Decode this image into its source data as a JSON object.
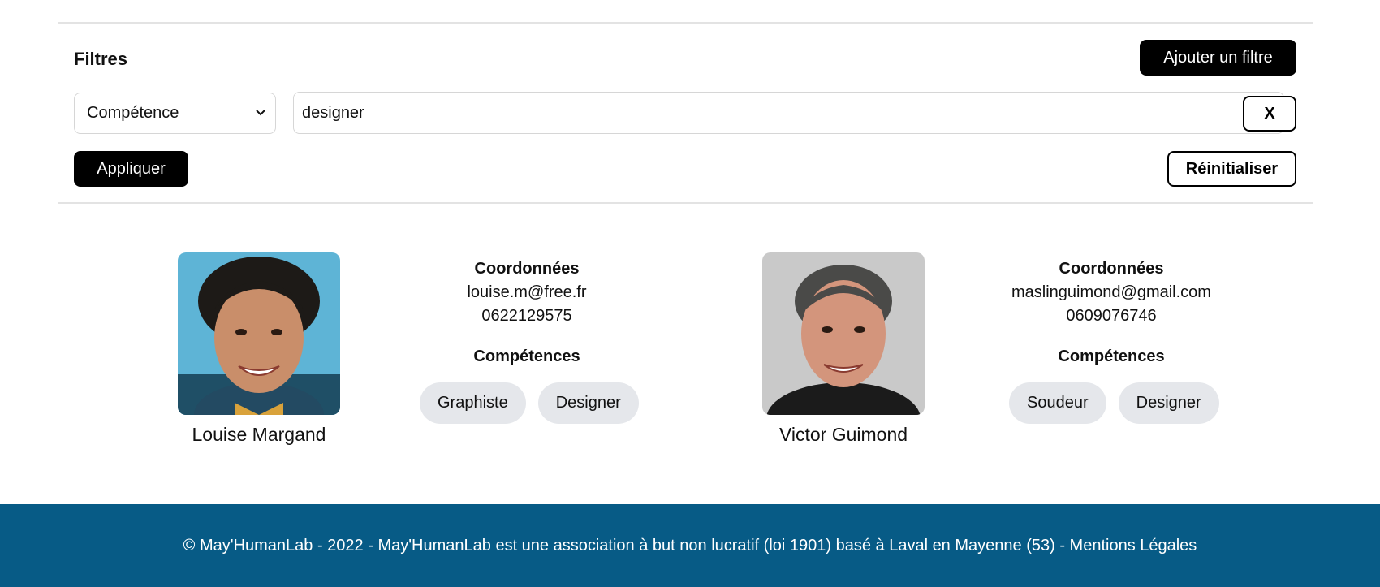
{
  "filters": {
    "title": "Filtres",
    "add_filter_label": "Ajouter un filtre",
    "field_select_value": "Compétence",
    "search_value": "designer",
    "clear_label": "X",
    "apply_label": "Appliquer",
    "reset_label": "Réinitialiser"
  },
  "profiles": [
    {
      "name": "Louise Margand",
      "contact_heading": "Coordonnées",
      "email": "louise.m@free.fr",
      "phone": "0622129575",
      "skills_heading": "Compétences",
      "skills": [
        "Graphiste",
        "Designer"
      ]
    },
    {
      "name": "Victor Guimond",
      "contact_heading": "Coordonnées",
      "email": "maslinguimond@gmail.com",
      "phone": "0609076746",
      "skills_heading": "Compétences",
      "skills": [
        "Soudeur",
        "Designer"
      ]
    }
  ],
  "footer": {
    "text": "© May'HumanLab - 2022 - May'HumanLab est une association à but non lucratif (loi 1901) basé à Laval en Mayenne (53) - Mentions Légales"
  },
  "colors": {
    "footer_bg": "#075b86",
    "chip_bg": "#e5e7eb",
    "button_dark": "#000000"
  }
}
